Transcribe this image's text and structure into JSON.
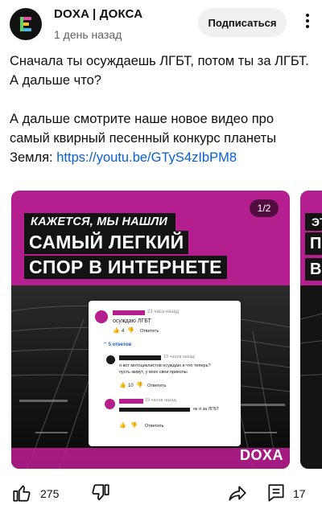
{
  "channel": {
    "name": "DOXA | ДОКСА",
    "posted": "1 день назад",
    "subscribe_label": "Подписаться"
  },
  "post": {
    "line1": "Сначала ты осуждаешь ЛГБТ, потом ты за ЛГБТ.",
    "line2": "А дальше что?",
    "line3": "А дальше смотрите наше новое видео про самый квирный песенный конкурс планеты Земля: ",
    "link": "https://youtu.be/GTyS4zIbPM8"
  },
  "slide": {
    "counter": "1/2",
    "kicker": "КАЖЕТСЯ, МЫ НАШЛИ",
    "headline_line1": "САМЫЙ ЛЕГКИЙ",
    "headline_line2": "СПОР В ИНТЕРНЕТЕ",
    "logo": "DOXA",
    "comments": {
      "c1_time": "23 часа назад",
      "c1_text": "осуждаю ЛГБТ",
      "c1_likes": "4",
      "reply_label": "Ответить",
      "replies_label": "5 ответов",
      "c2_time": "19 часов назад",
      "c2_text_line1": "я вот мотоциклистов осуждаю и что теперь?",
      "c2_text_line2": "пусть живут, у всех свои приколы",
      "c2_likes": "10",
      "c3_time": "19 часов назад",
      "c3_text": "ок я за ЛГБТ"
    }
  },
  "peek": {
    "kicker": "ЭТ",
    "head_line1": "П",
    "head_line2": "В"
  },
  "actions": {
    "likes": "275",
    "comments": "17"
  },
  "colors": {
    "brand_magenta": "#b51e8e",
    "link_blue": "#065fd4",
    "reply_blue": "#1a5ac9"
  }
}
